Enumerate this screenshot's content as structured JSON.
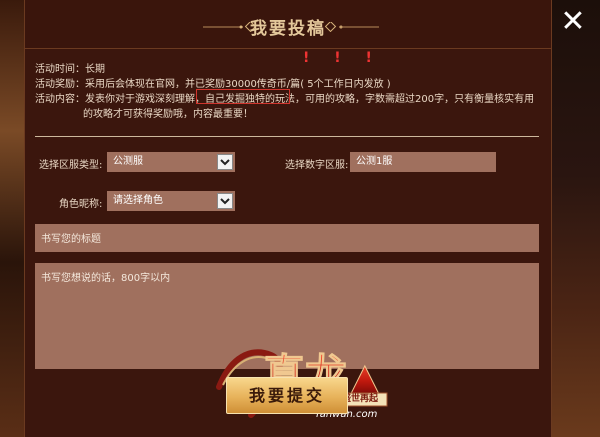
{
  "dialog": {
    "title": "我要投稿",
    "close_label": "✕"
  },
  "info": {
    "time_label": "活动时间：",
    "time_value": "长期",
    "reward_label": "活动奖励：",
    "reward_prefix": "采用后会体现在官网，并已",
    "reward_highlight": "奖励30000传奇币/篇",
    "reward_suffix": "( 5个工作日内发放 )",
    "reward_marks": "! ! !",
    "content_label": "活动内容：",
    "content_line1": "发表你对于游戏深刻理解，自己发掘独特的玩法，可用的攻略，字数需超过200字，只有衡量核实有用",
    "content_line2": "的攻略才可获得奖励哦，内容最重要！"
  },
  "form": {
    "server_type_label": "选择区服类型:",
    "server_type_value": "公测服",
    "server_num_label": "选择数字区服:",
    "server_num_value": "公测1服",
    "role_label": "角色昵称:",
    "role_value": "请选择角色",
    "title_placeholder": "书写您的标题",
    "body_placeholder": "书写您想说的话，800字以内"
  },
  "logo": {
    "main_text": "真龙",
    "sub_text": "Tanwan.com",
    "tag_text": "盛世再起"
  },
  "submit_label": "我要提交",
  "colors": {
    "panel_bg": "#3b160d",
    "field_bg": "#a0705e",
    "accent_gold": "#e3c79a",
    "highlight_red": "#d0352d"
  }
}
